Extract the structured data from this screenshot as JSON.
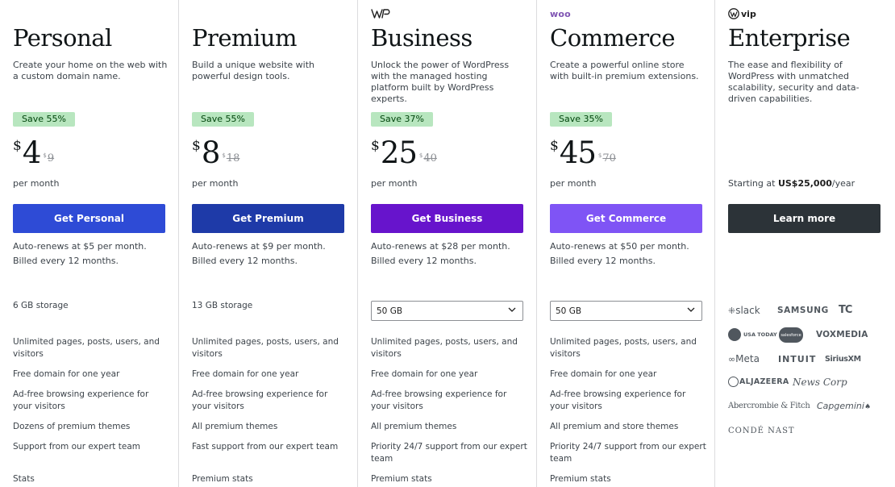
{
  "colors": {
    "personal": "#2e4bd6",
    "premium": "#1e3aa8",
    "business": "#6714cc",
    "commerce": "#7f54f5",
    "enterprise": "#2c3338",
    "badge_bg": "#b8e6bf"
  },
  "plans": [
    {
      "name": "Personal",
      "description": "Create your home on the web with a custom domain name.",
      "badge": "Save 55%",
      "currency": "$",
      "price": "4",
      "original_currency": "$",
      "original_price": "9",
      "per": "per month",
      "button": "Get Personal",
      "renew": "Auto-renews at $5 per month. Billed every 12 months.",
      "storage": "6 GB storage",
      "features": [
        "Unlimited pages, posts, users, and visitors",
        "Free domain for one year",
        "Ad-free browsing experience for your visitors",
        "Dozens of premium themes",
        "Support from our expert team",
        "Stats"
      ]
    },
    {
      "name": "Premium",
      "description": "Build a unique website with powerful design tools.",
      "badge": "Save 55%",
      "currency": "$",
      "price": "8",
      "original_currency": "$",
      "original_price": "18",
      "per": "per month",
      "button": "Get Premium",
      "renew": "Auto-renews at $9 per month. Billed every 12 months.",
      "storage": "13 GB storage",
      "features": [
        "Unlimited pages, posts, users, and visitors",
        "Free domain for one year",
        "Ad-free browsing experience for your visitors",
        "All premium themes",
        "Fast support from our expert team",
        "Premium stats"
      ]
    },
    {
      "name": "Business",
      "brand_icon": "wordpress-wp-icon",
      "description": "Unlock the power of WordPress with the managed hosting platform built by WordPress experts.",
      "badge": "Save 37%",
      "currency": "$",
      "price": "25",
      "original_currency": "$",
      "original_price": "40",
      "per": "per month",
      "button": "Get Business",
      "renew": "Auto-renews at $28 per month. Billed every 12 months.",
      "storage_select": "50 GB",
      "features": [
        "Unlimited pages, posts, users, and visitors",
        "Free domain for one year",
        "Ad-free browsing experience for your visitors",
        "All premium themes",
        "Priority 24/7 support from our expert team",
        "Premium stats"
      ]
    },
    {
      "name": "Commerce",
      "brand_text": "woo",
      "description": "Create a powerful online store with built-in premium extensions.",
      "badge": "Save 35%",
      "currency": "$",
      "price": "45",
      "original_currency": "$",
      "original_price": "70",
      "per": "per month",
      "button": "Get Commerce",
      "renew": "Auto-renews at $50 per month. Billed every 12 months.",
      "storage_select": "50 GB",
      "features": [
        "Unlimited pages, posts, users, and visitors",
        "Free domain for one year",
        "Ad-free browsing experience for your visitors",
        "All premium and store themes",
        "Priority 24/7 support from our expert team",
        "Premium stats"
      ]
    },
    {
      "name": "Enterprise",
      "brand_text": "vip",
      "description": "The ease and flexibility of WordPress with unmatched scalability, security and data-driven capabilities.",
      "starting_prefix": "Starting at ",
      "starting_price": "US$25,000",
      "starting_suffix": "/year",
      "button": "Learn more",
      "logos": [
        "slack",
        "SAMSUNG",
        "TC",
        "USA TODAY",
        "salesforce",
        "VOXMEDIA",
        "Meta",
        "INTUIT",
        "SiriusXM",
        "ALJAZEERA",
        "News Corp",
        "Abercrombie & Fitch",
        "Capgemini",
        "CONDÉ NAST"
      ]
    }
  ]
}
